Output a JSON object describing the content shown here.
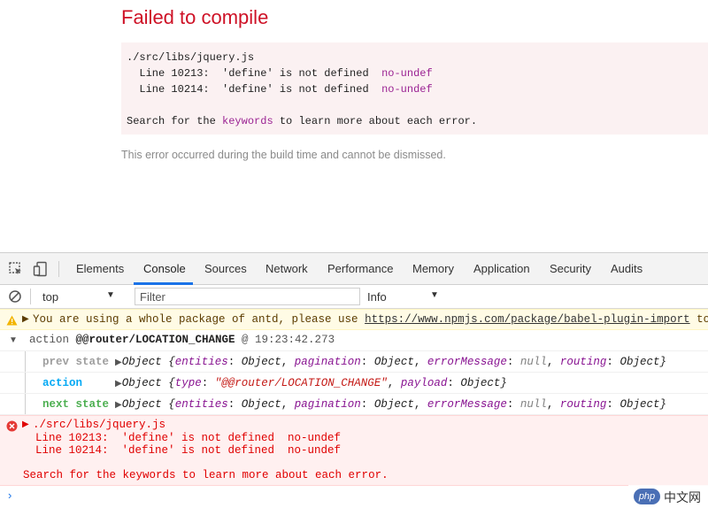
{
  "overlay": {
    "title": "Failed to compile",
    "file": "./src/libs/jquery.js",
    "errors": [
      {
        "line": "Line 10213:",
        "msg": "'define' is not defined",
        "rule": "no-undef"
      },
      {
        "line": "Line 10214:",
        "msg": "'define' is not defined",
        "rule": "no-undef"
      }
    ],
    "search_prefix": "Search for the ",
    "search_keyword": "keywords",
    "search_suffix": " to learn more about each error.",
    "note": "This error occurred during the build time and cannot be dismissed."
  },
  "devtools": {
    "icons": [
      "inspect-icon",
      "device-toggle-icon"
    ],
    "tabs": [
      "Elements",
      "Console",
      "Sources",
      "Network",
      "Performance",
      "Memory",
      "Application",
      "Security",
      "Audits"
    ],
    "active_tab": "Console",
    "filterbar": {
      "context": "top",
      "filter_placeholder": "Filter",
      "level": "Info"
    },
    "warning": {
      "text": "You are using a whole package of antd, please use ",
      "link": "https://www.npmjs.com/package/babel-plugin-import",
      "suffix": " to r"
    },
    "action_log": {
      "prefix": "action ",
      "type": "@@router/LOCATION_CHANGE",
      "time": " @ 19:23:42.273"
    },
    "group": {
      "prev_label": "prev state",
      "action_label": "action",
      "next_label": "next state",
      "state_obj": "Object {",
      "entities_key": "entities",
      "entities_val": "Object",
      "pagination_key": "pagination",
      "pagination_val": "Object",
      "error_key": "errorMessage",
      "error_val": "null",
      "routing_key": "routing",
      "routing_val": "Object",
      "action_obj": "Object {",
      "type_key": "type",
      "type_val": "\"@@router/LOCATION_CHANGE\"",
      "payload_key": "payload",
      "payload_val": "Object"
    },
    "error_block": {
      "file": "./src/libs/jquery.js",
      "line1": "Line 10213:  'define' is not defined  no-undef",
      "line2": "Line 10214:  'define' is not defined  no-undef",
      "search": "Search for the keywords to learn more about each error."
    },
    "prompt": "›"
  },
  "watermark": {
    "logo": "php",
    "text": "中文网"
  },
  "colors": {
    "error_red": "#ce1126",
    "console_error": "#e00000",
    "tab_active": "#1a73e8",
    "warning_bg": "#fffbe5"
  }
}
